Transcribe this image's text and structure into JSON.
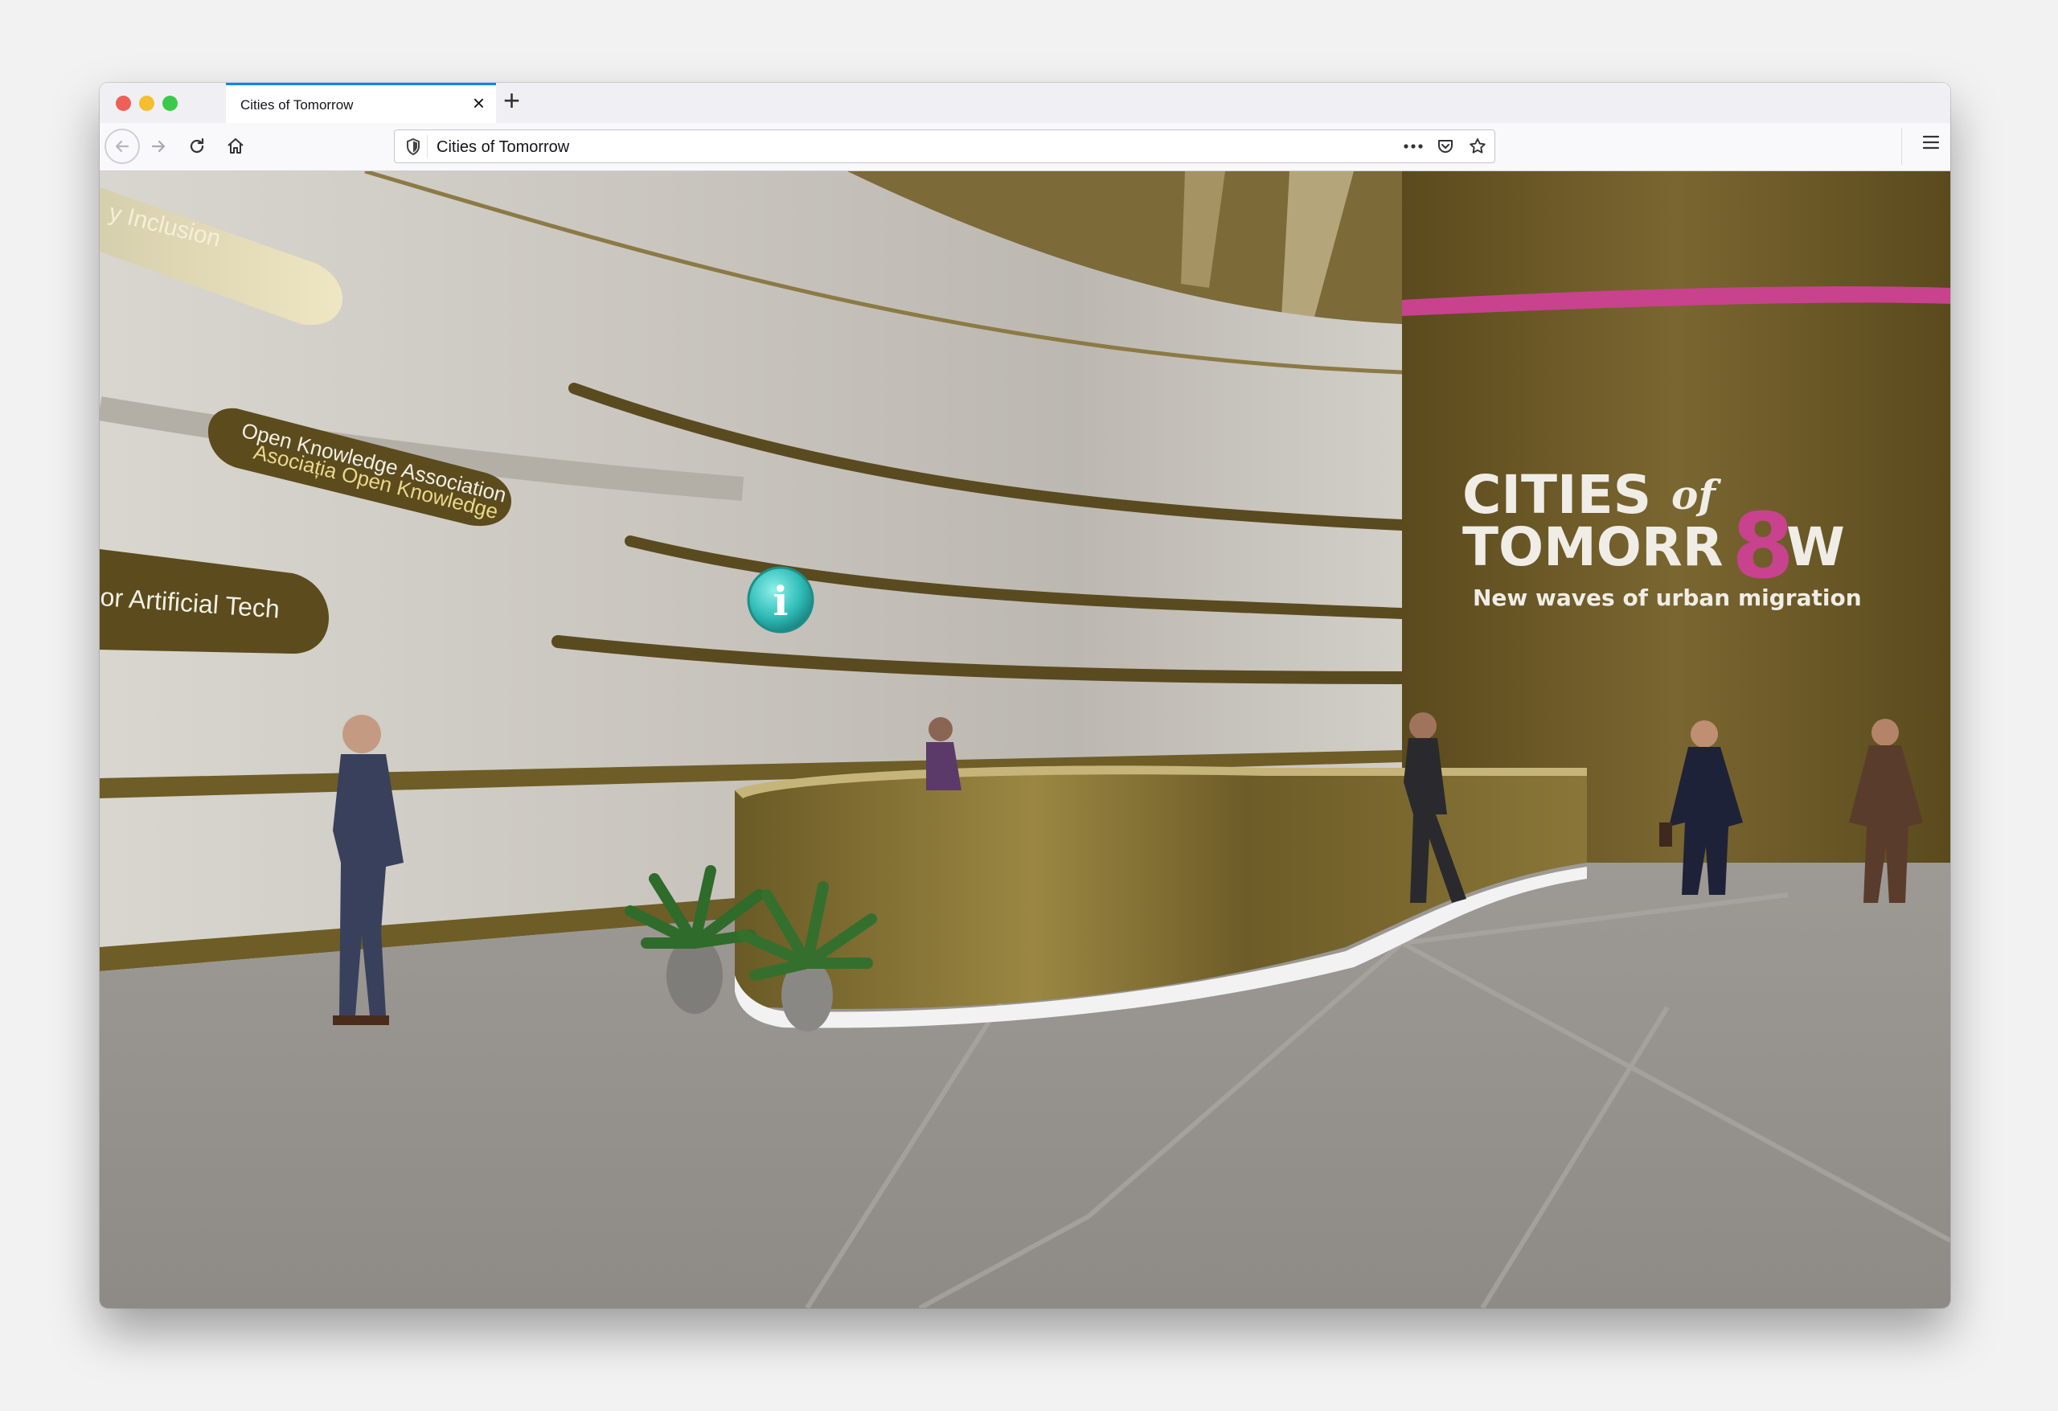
{
  "browser": {
    "tab_title": "Cities of Tomorrow",
    "url": "Cities of Tomorrow"
  },
  "icons": {
    "close_tab": "close-icon",
    "new_tab": "plus-icon",
    "back": "arrow-left-icon",
    "forward": "arrow-right-icon",
    "reload": "reload-icon",
    "home": "home-icon",
    "shield": "shield-icon",
    "more": "more-icon",
    "pocket": "pocket-icon",
    "bookmark": "star-icon",
    "menu": "hamburger-icon",
    "info": "info-icon"
  },
  "scene": {
    "banner_1": "y Inclusion",
    "banner_2_line1": "Open Knowledge Association",
    "banner_2_line2": "Asociația Open Knowledge",
    "banner_3": "or Artificial Tech",
    "logo_cities": "CITIES",
    "logo_of": "of",
    "logo_tomorr": "TOMORR",
    "logo_8": "8",
    "logo_w": "W",
    "logo_tagline": "New waves of urban migration",
    "info_glyph": "i"
  },
  "colors": {
    "accent_tab": "#0a84ff",
    "brand_magenta": "#c8428e",
    "wall_gold": "#6e5a26",
    "info_teal": "#3cc4c0"
  }
}
